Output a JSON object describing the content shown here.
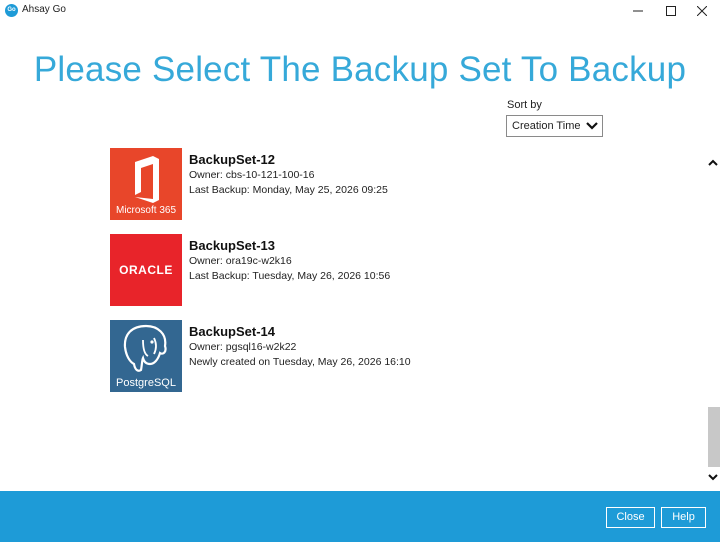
{
  "window": {
    "title": "Ahsay Go",
    "icon_text": "Go"
  },
  "page": {
    "title": "Please Select The Backup Set To Backup"
  },
  "sort": {
    "label": "Sort by",
    "selected": "Creation Time"
  },
  "backup_sets": [
    {
      "name": "BackupSet-12",
      "owner": "Owner: cbs-10-121-100-16",
      "status": "Last Backup: Monday, May 25, 2026 09:25",
      "logo": "microsoft-365-icon",
      "logo_text": "Microsoft 365"
    },
    {
      "name": "BackupSet-13",
      "owner": "Owner: ora19c-w2k16",
      "status": "Last Backup: Tuesday, May 26, 2026 10:56",
      "logo": "oracle-icon",
      "logo_text": "ORACLE"
    },
    {
      "name": "BackupSet-14",
      "owner": "Owner: pgsql16-w2k22",
      "status": "Newly created on Tuesday, May 26, 2026 16:10",
      "logo": "postgresql-icon",
      "logo_text": "PostgreSQL"
    }
  ],
  "footer": {
    "close_label": "Close",
    "help_label": "Help"
  },
  "colors": {
    "accent": "#36a9d9",
    "footer": "#1e9bd7",
    "ms365": "#e8462a",
    "oracle": "#e8242a",
    "postgres": "#336791"
  }
}
